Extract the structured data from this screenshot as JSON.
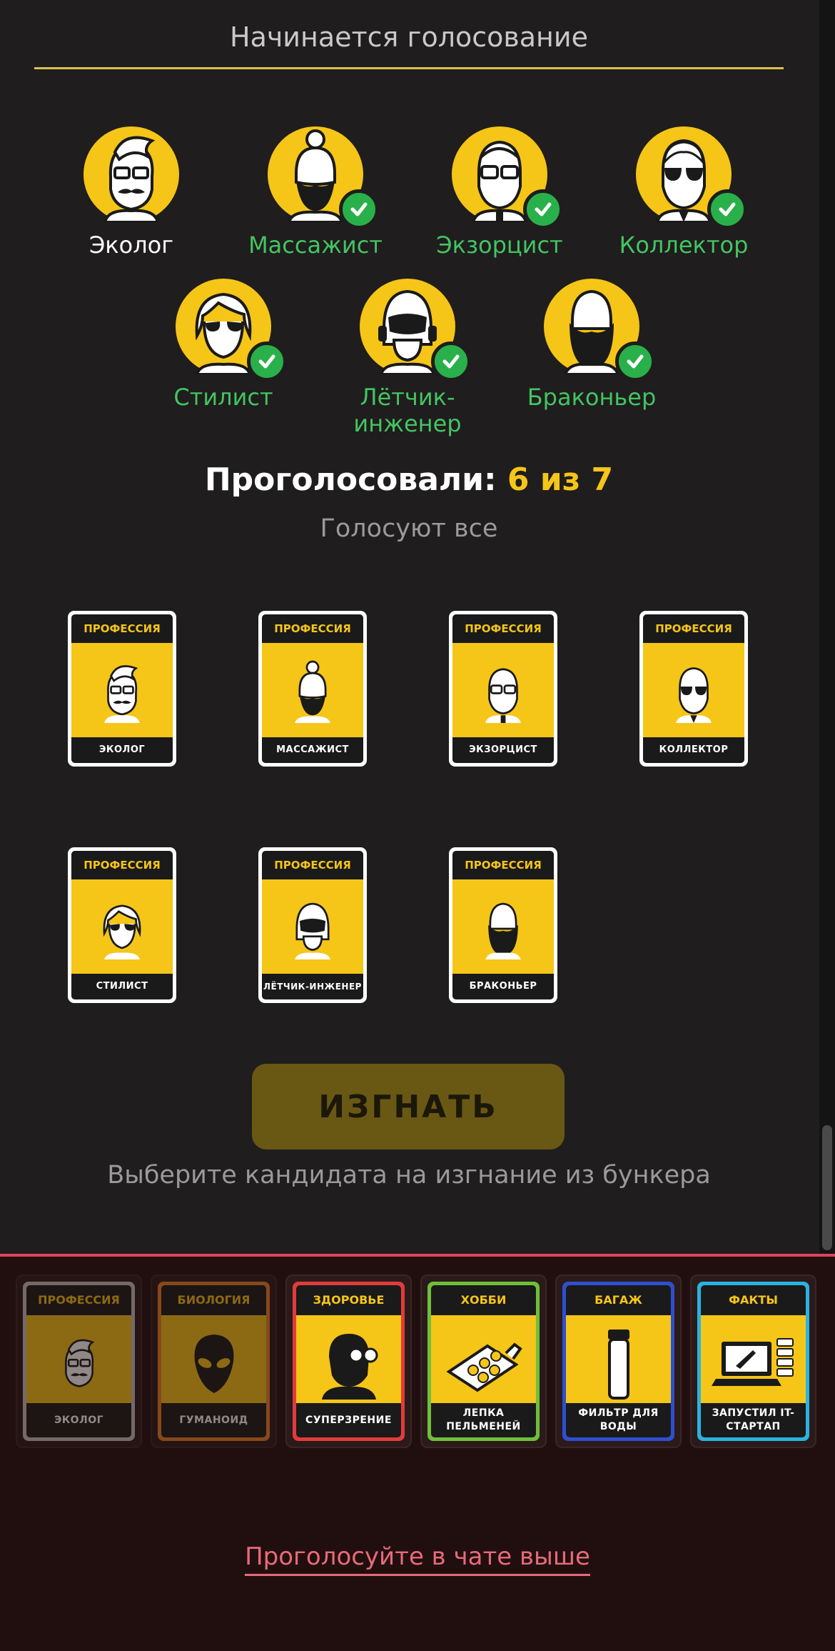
{
  "header": {
    "title": "Начинается голосование"
  },
  "players": [
    {
      "name": "Эколог",
      "voted": false,
      "color": "white",
      "icon": "ecologist-avatar-icon"
    },
    {
      "name": "Массажист",
      "voted": true,
      "color": "green",
      "icon": "masseur-avatar-icon"
    },
    {
      "name": "Экзорцист",
      "voted": true,
      "color": "green",
      "icon": "exorcist-avatar-icon"
    },
    {
      "name": "Коллектор",
      "voted": true,
      "color": "green",
      "icon": "collector-avatar-icon"
    },
    {
      "name": "Стилист",
      "voted": true,
      "color": "green",
      "icon": "stylist-avatar-icon"
    },
    {
      "name": "Лётчик-инженер",
      "voted": true,
      "color": "green",
      "icon": "pilot-avatar-icon"
    },
    {
      "name": "Браконьер",
      "voted": true,
      "color": "green",
      "icon": "poacher-avatar-icon"
    }
  ],
  "votes": {
    "label": "Проголосовали:",
    "count": "6 из 7"
  },
  "voting_mode": "Голосуют все",
  "candidates": [
    {
      "category": "ПРОФЕССИЯ",
      "name": "ЭКОЛОГ"
    },
    {
      "category": "ПРОФЕССИЯ",
      "name": "МАССАЖИСТ"
    },
    {
      "category": "ПРОФЕССИЯ",
      "name": "ЭКЗОРЦИСТ"
    },
    {
      "category": "ПРОФЕССИЯ",
      "name": "КОЛЛЕКТОР"
    },
    {
      "category": "ПРОФЕССИЯ",
      "name": "СТИЛИСТ"
    },
    {
      "category": "ПРОФЕССИЯ",
      "name": "ЛЁТЧИК-ИНЖЕНЕР"
    },
    {
      "category": "ПРОФЕССИЯ",
      "name": "БРАКОНЬЕР"
    }
  ],
  "kick_button": "ИЗГНАТЬ",
  "kick_hint": "Выберите кандидата на изгнание из бункера",
  "hand": [
    {
      "category": "ПРОФЕССИЯ",
      "value": "ЭКОЛОГ",
      "border": "#c9c2bf",
      "icon": "ecologist-icon",
      "dimmed": true
    },
    {
      "category": "БИОЛОГИЯ",
      "value": "ГУМАНОИД",
      "border": "#e8832a",
      "icon": "alien-icon",
      "dimmed": true
    },
    {
      "category": "ЗДОРОВЬЕ",
      "value": "СУПЕРЗРЕНИЕ",
      "border": "#e23b3b",
      "icon": "superman-vision-icon",
      "dimmed": false
    },
    {
      "category": "ХОББИ",
      "value": "ЛЕПКА ПЕЛЬМЕНЕЙ",
      "border": "#6fbf3a",
      "icon": "dumpling-board-icon",
      "dimmed": false
    },
    {
      "category": "БАГАЖ",
      "value": "ФИЛЬТР ДЛЯ ВОДЫ",
      "border": "#2f4fd1",
      "icon": "water-filter-icon",
      "dimmed": false
    },
    {
      "category": "ФАКТЫ",
      "value": "ЗАПУСТИЛ IT-СТАРТАП",
      "border": "#29b3e0",
      "icon": "laptop-rocket-icon",
      "dimmed": false
    }
  ],
  "footer_link": "Проголосуйте в чате выше",
  "colors": {
    "accent": "#f5c518",
    "voted": "#43c463",
    "danger": "#e0435a"
  }
}
